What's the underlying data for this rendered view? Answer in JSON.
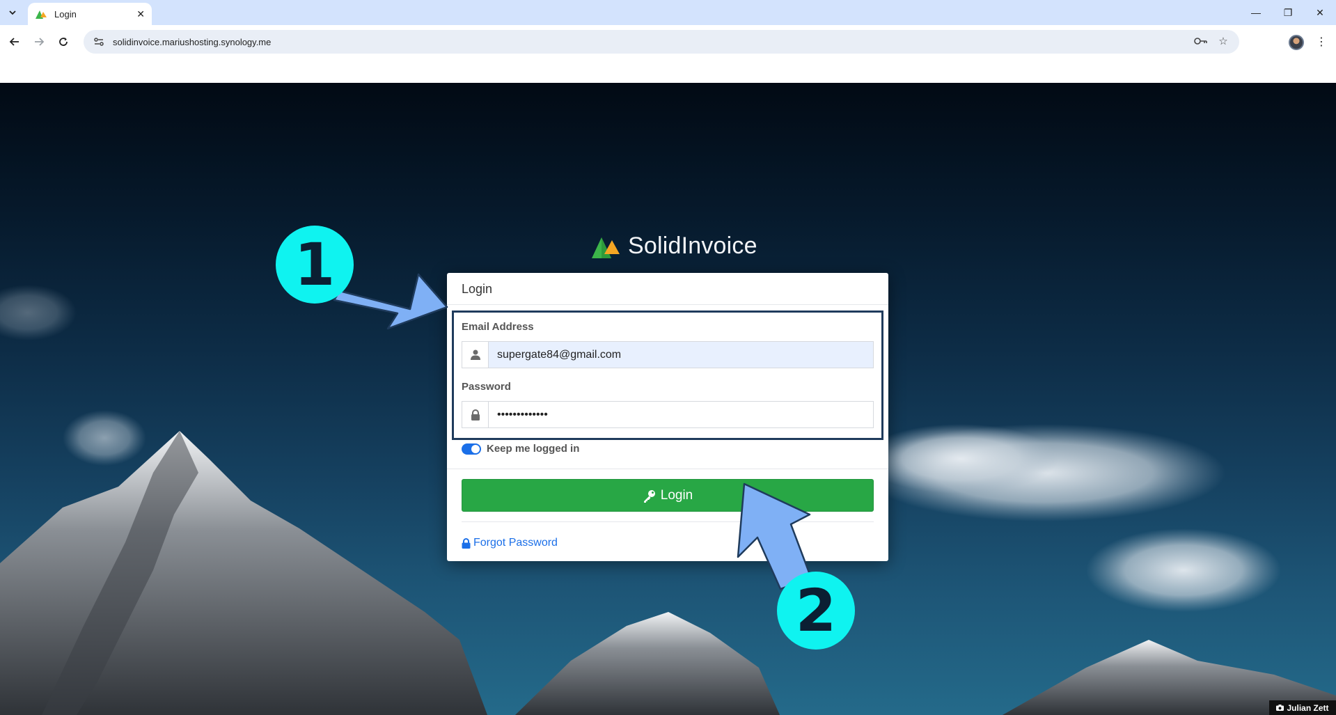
{
  "browser": {
    "tab_title": "Login",
    "url": "solidinvoice.mariushosting.synology.me"
  },
  "brand": {
    "name": "SolidInvoice"
  },
  "login_card": {
    "header": "Login",
    "email_label": "Email Address",
    "email_value": "supergate84@gmail.com",
    "password_label": "Password",
    "password_value": "•••••••••••••",
    "remember_label": "Keep me logged in",
    "remember_checked": true,
    "login_button": "Login",
    "forgot_link": "Forgot Password"
  },
  "annotations": {
    "step1": "1",
    "step2": "2"
  },
  "photo_credit": "Julian Zett",
  "colors": {
    "accent": "#28a745",
    "link": "#1b6fe8",
    "badge": "#0ff3f0",
    "arrow": "#7fb0f5"
  }
}
